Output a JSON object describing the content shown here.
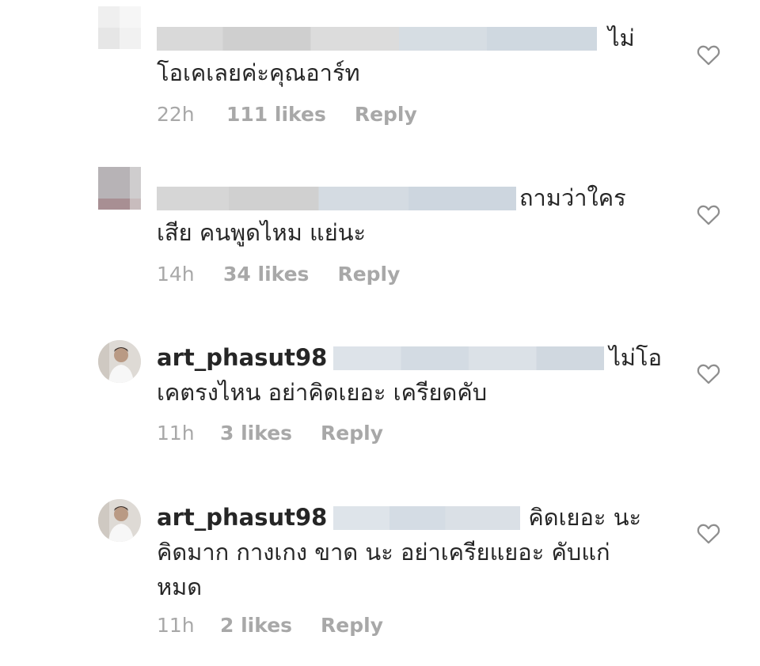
{
  "comments": [
    {
      "username": "",
      "text_line1": "ไม่",
      "text_line2": "โอเคเลยค่ะคุณอาร์ท",
      "time": "22h",
      "likes": "111 likes",
      "reply": "Reply",
      "avatar_icon": "pixelated-avatar-icon"
    },
    {
      "username": "",
      "text_line1": "ถามว่าใคร",
      "text_line2": "เสีย คนพูดไหม แย่นะ",
      "time": "14h",
      "likes": "34 likes",
      "reply": "Reply",
      "avatar_icon": "pixelated-avatar-icon"
    },
    {
      "username": "art_phasut98",
      "text_line1": "ไม่โอ",
      "text_line2": "เคตรงไหน อย่าคิดเยอะ เครียดคับ",
      "time": "11h",
      "likes": "3 likes",
      "reply": "Reply",
      "avatar_icon": "profile-photo-avatar"
    },
    {
      "username": "art_phasut98",
      "text_line1": "คิดเยอะ นะ",
      "text_line2": "คิดมาก กางเกง ขาด นะ อย่าเครียแยอะ คับแก่",
      "text_line3": "หมด",
      "time": "11h",
      "likes": "2 likes",
      "reply": "Reply",
      "avatar_icon": "profile-photo-avatar"
    }
  ],
  "colors": {
    "text": "#262626",
    "meta": "#a8a8a8",
    "heart": "#8e8e8e",
    "blur_gray": "#d6d6d6",
    "blur_blue": "#d7dee6"
  },
  "icons": {
    "like": "heart-outline-icon"
  }
}
